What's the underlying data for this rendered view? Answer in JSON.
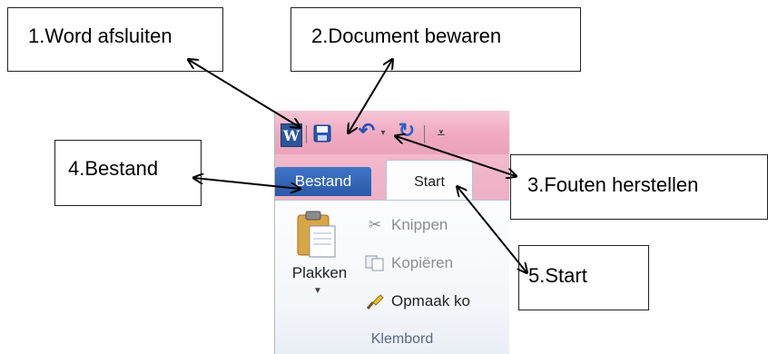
{
  "qat": {
    "word_icon_letter": "W",
    "icons": [
      "word-icon",
      "save-icon",
      "undo-icon",
      "redo-icon",
      "customize-icon"
    ]
  },
  "tabs": {
    "file": "Bestand",
    "home": "Start"
  },
  "ribbon": {
    "paste": "Plakken",
    "cut": "Knippen",
    "copy": "Kopiëren",
    "format_painter": "Opmaak ko",
    "group_label": "Klembord"
  },
  "callouts": {
    "c1": "1.Word afsluiten",
    "c2": "2.Document bewaren",
    "c3": "3.Fouten herstellen",
    "c4": "4.Bestand",
    "c5": "5.Start"
  },
  "colors": {
    "title_bar_pink": "#f0a9c0",
    "file_tab_blue": "#2a5aa8",
    "arrow": "#000000"
  }
}
